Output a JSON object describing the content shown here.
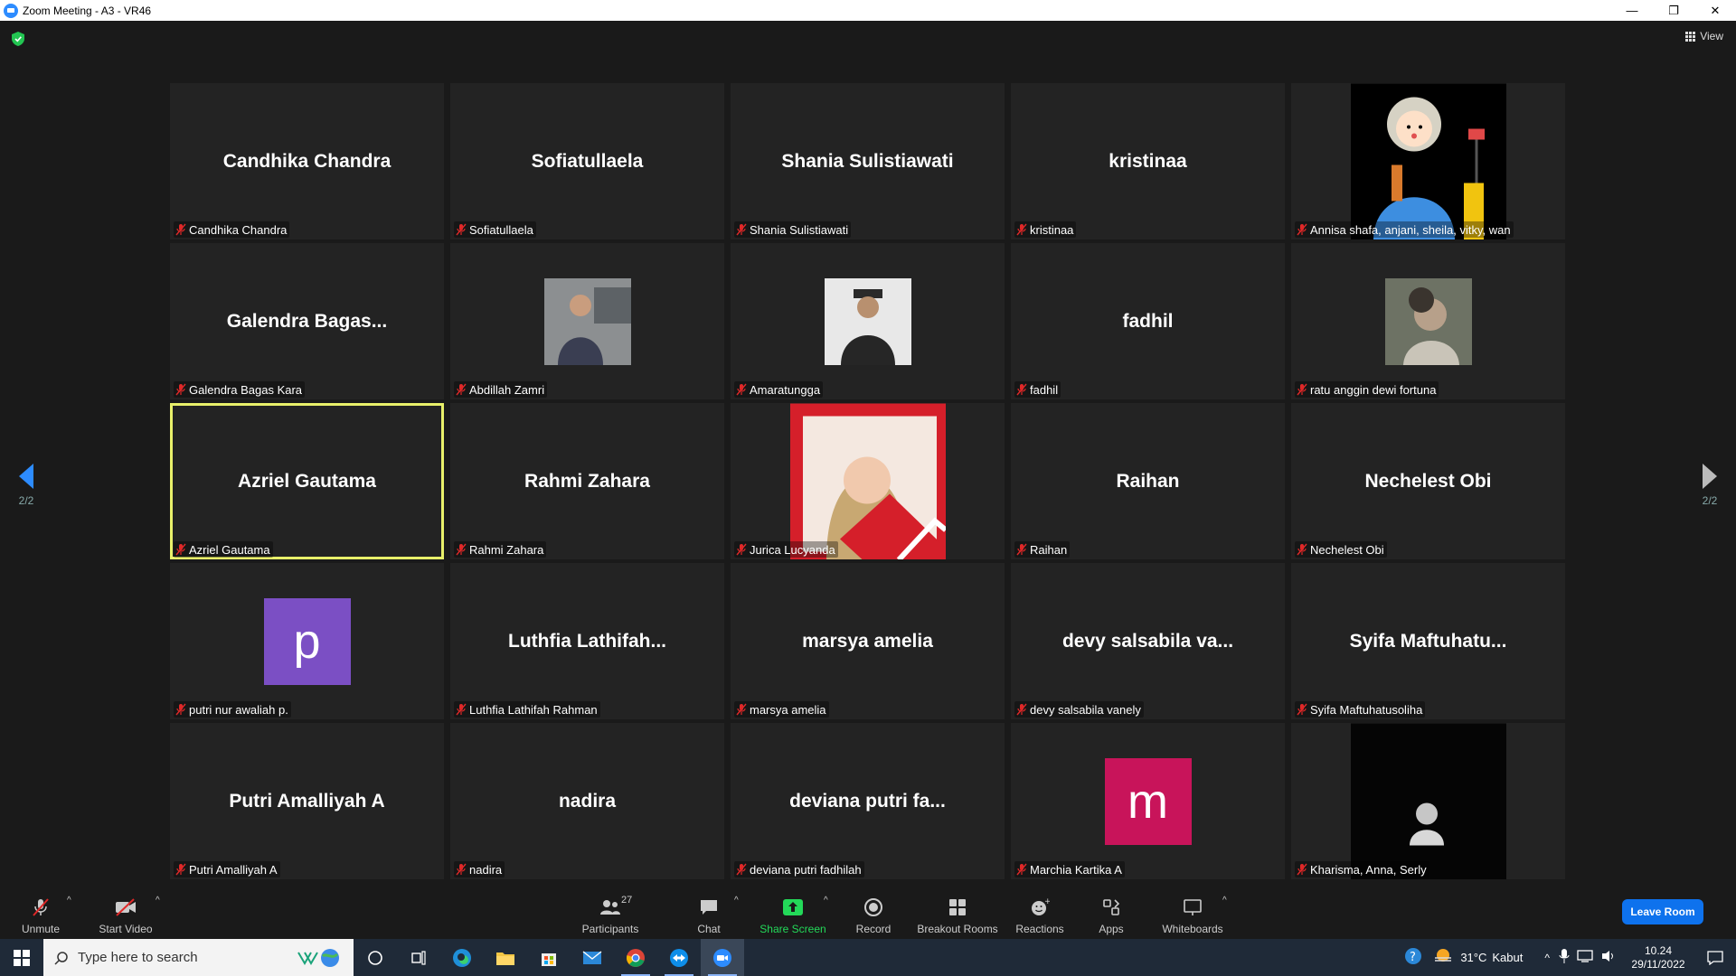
{
  "window": {
    "title": "Zoom Meeting - A3 - VR46",
    "minimize": "—",
    "restore": "❐",
    "close": "✕"
  },
  "meeting": {
    "view_label": "View",
    "page_indicator_left": "2/2",
    "page_indicator_right": "2/2",
    "participants": [
      {
        "display": "Candhika Chandra",
        "tag": "Candhika Chandra"
      },
      {
        "display": "Sofiatullaela",
        "tag": "Sofiatullaela"
      },
      {
        "display": "Shania Sulistiawati",
        "tag": "Shania Sulistiawati"
      },
      {
        "display": "kristinaa",
        "tag": "kristinaa"
      },
      {
        "display": "",
        "tag": "Annisa shafa, anjani, sheila, vitky, wan"
      },
      {
        "display": "Galendra  Bagas...",
        "tag": "Galendra Bagas Kara"
      },
      {
        "display": "",
        "tag": "Abdillah Zamri"
      },
      {
        "display": "",
        "tag": "Amaratungga"
      },
      {
        "display": "fadhil",
        "tag": "fadhil"
      },
      {
        "display": "",
        "tag": "ratu anggin dewi fortuna"
      },
      {
        "display": "Azriel Gautama",
        "tag": "Azriel Gautama"
      },
      {
        "display": "Rahmi Zahara",
        "tag": "Rahmi Zahara"
      },
      {
        "display": "",
        "tag": "Jurica Lucyanda"
      },
      {
        "display": "Raihan",
        "tag": "Raihan"
      },
      {
        "display": "Nechelest Obi",
        "tag": "Nechelest Obi"
      },
      {
        "display": "p",
        "tag": "putri nur awaliah p."
      },
      {
        "display": "Luthfia  Lathifah...",
        "tag": "Luthfia Lathifah Rahman"
      },
      {
        "display": "marsya amelia",
        "tag": "marsya amelia"
      },
      {
        "display": "devy salsabila va...",
        "tag": "devy salsabila vanely"
      },
      {
        "display": "Syifa  Maftuhatu...",
        "tag": "Syifa Maftuhatusoliha"
      },
      {
        "display": "Putri Amalliyah A",
        "tag": "Putri Amalliyah A"
      },
      {
        "display": "nadira",
        "tag": "nadira"
      },
      {
        "display": "deviana putri fa...",
        "tag": "deviana putri fadhilah"
      },
      {
        "display": "m",
        "tag": "Marchia Kartika A"
      },
      {
        "display": "",
        "tag": "Kharisma, Anna, Serly"
      }
    ]
  },
  "toolbar": {
    "unmute": "Unmute",
    "start_video": "Start Video",
    "participants": "Participants",
    "participants_count": "27",
    "chat": "Chat",
    "share_screen": "Share Screen",
    "record": "Record",
    "breakout_rooms": "Breakout Rooms",
    "reactions": "Reactions",
    "apps": "Apps",
    "whiteboards": "Whiteboards",
    "leave": "Leave Room"
  },
  "taskbar": {
    "search_placeholder": "Type here to search",
    "weather_temp": "31°C",
    "weather_desc": "Kabut",
    "time": "10.24",
    "date": "29/11/2022"
  },
  "colors": {
    "active_speaker_border": "#e8f06a",
    "letter_p_avatar": "#7b4fc4",
    "letter_m_avatar": "#c8145a",
    "share_screen_green": "#23d959",
    "leave_button": "#0e72ed"
  }
}
